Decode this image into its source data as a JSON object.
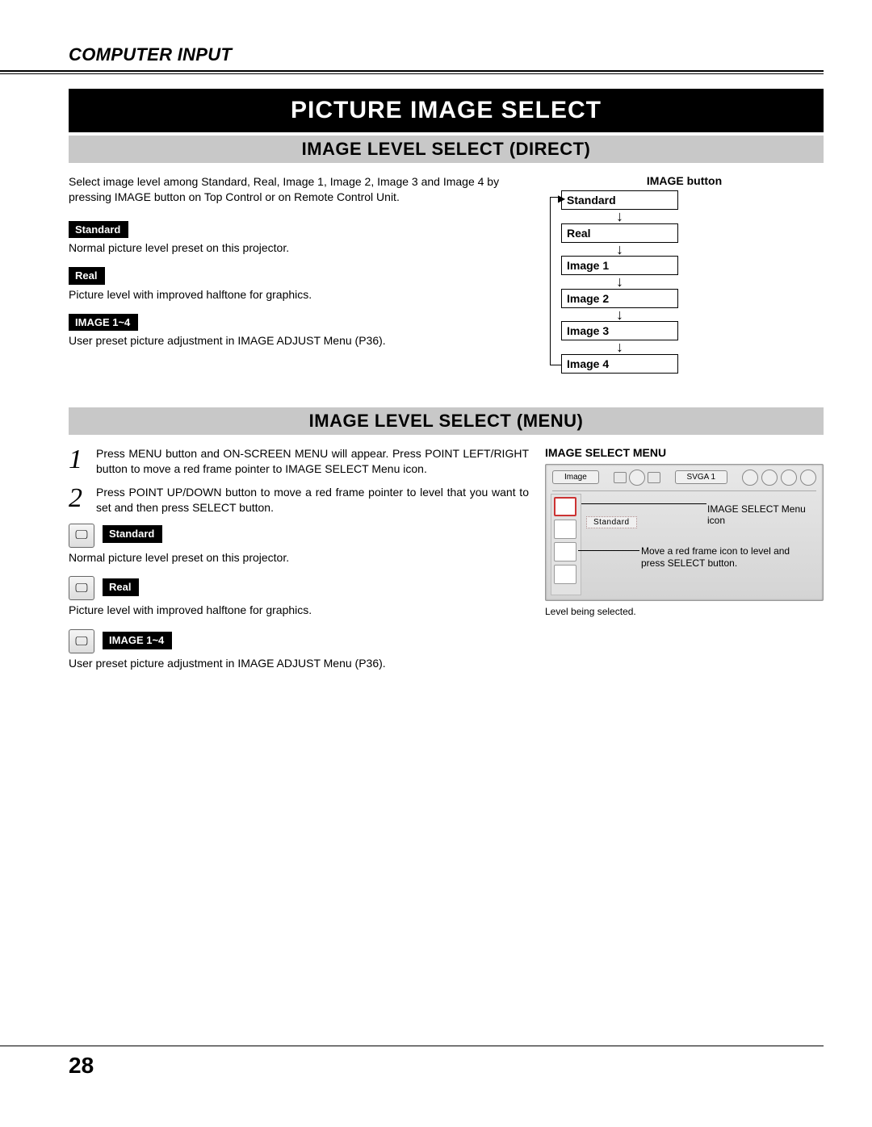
{
  "header": "COMPUTER INPUT",
  "title_bar": "PICTURE IMAGE SELECT",
  "sec1": {
    "heading": "IMAGE LEVEL SELECT (DIRECT)",
    "intro": "Select image level among Standard, Real, Image 1, Image 2, Image 3 and Image 4 by pressing IMAGE button on Top Control or on Remote Control Unit.",
    "options": [
      {
        "label": "Standard",
        "desc": "Normal picture level preset on this projector."
      },
      {
        "label": "Real",
        "desc": "Picture level with improved halftone for graphics."
      },
      {
        "label": "IMAGE 1~4",
        "desc": "User preset picture adjustment in IMAGE ADJUST Menu (P36)."
      }
    ],
    "diagram": {
      "title": "IMAGE button",
      "items": [
        "Standard",
        "Real",
        "Image 1",
        "Image 2",
        "Image 3",
        "Image 4"
      ]
    }
  },
  "sec2": {
    "heading": "IMAGE LEVEL SELECT (MENU)",
    "steps": [
      "Press MENU button and ON-SCREEN MENU will appear.  Press POINT LEFT/RIGHT button to move a red frame pointer to IMAGE SELECT Menu icon.",
      "Press POINT UP/DOWN button to move a red frame pointer to level that you want to set and then press SELECT button."
    ],
    "options": [
      {
        "label": "Standard",
        "desc": "Normal picture level preset on this projector."
      },
      {
        "label": "Real",
        "desc": "Picture level with improved halftone for graphics."
      },
      {
        "label": "IMAGE 1~4",
        "desc": "User preset picture adjustment in IMAGE ADJUST Menu (P36)."
      }
    ],
    "menu": {
      "title": "IMAGE SELECT MENU",
      "tab_label": "Image",
      "mode_label": "SVGA 1",
      "selected_item": "Standard",
      "callout1": "IMAGE SELECT Menu icon",
      "callout2": "Move a red frame icon to level and press SELECT button.",
      "note_below": "Level being selected."
    }
  },
  "page_number": "28"
}
